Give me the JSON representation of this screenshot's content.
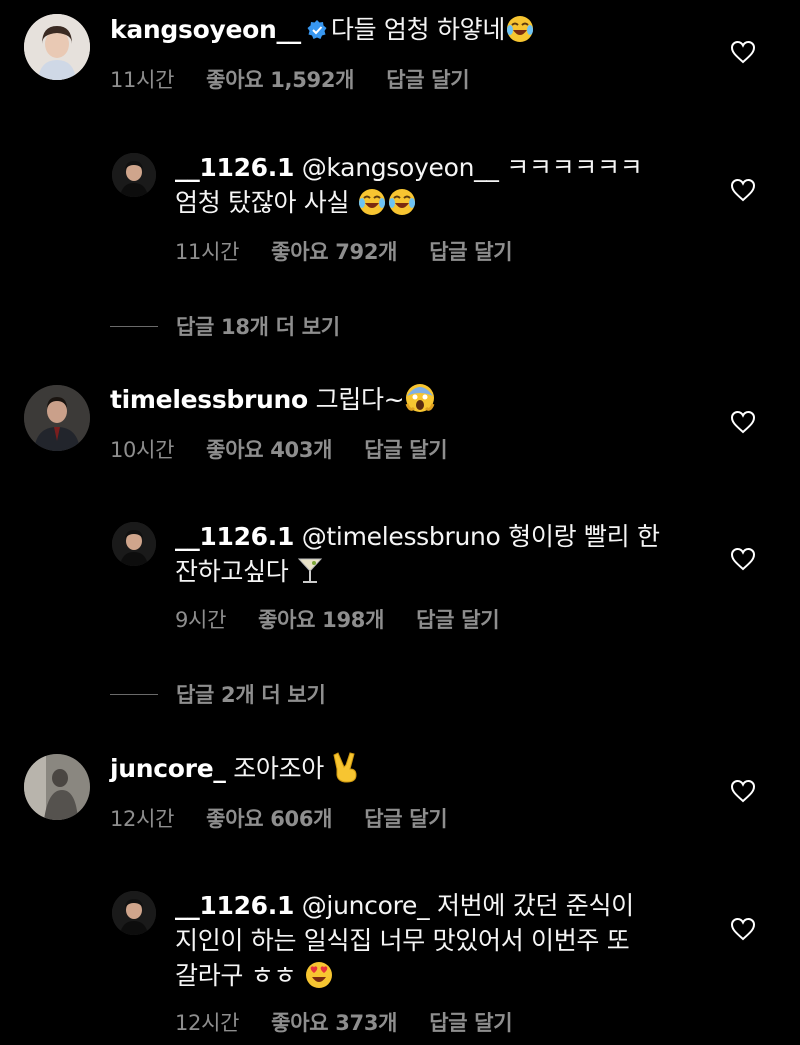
{
  "comments": [
    {
      "username": "kangsoyeon__",
      "text": "다들 엄청 하얗네",
      "time": "11시간",
      "likes": "좋아요 1,592개",
      "reply": "답글 달기",
      "emoji": "laughing-tears-icon",
      "replies": [
        {
          "username": "__1126.1",
          "text_line1": "@kangsoyeon__  ㅋㅋㅋㅋㅋㅋ",
          "text_line2": "엄청 탔잖아 사실",
          "time": "11시간",
          "likes": "좋아요 792개",
          "reply": "답글 달기"
        }
      ],
      "view_more": "답글 18개 더 보기"
    },
    {
      "username": "timelessbruno",
      "text": "그립다~",
      "time": "10시간",
      "likes": "좋아요 403개",
      "reply": "답글 달기",
      "emoji": "screaming-face-icon",
      "replies": [
        {
          "username": "__1126.1",
          "text_line1": "@timelessbruno 형이랑 빨리 한",
          "text_line2": "잔하고싶다",
          "time": "9시간",
          "likes": "좋아요 198개",
          "reply": "답글 달기"
        }
      ],
      "view_more": "답글 2개 더 보기"
    },
    {
      "username": "juncore_",
      "text": "조아조아",
      "time": "12시간",
      "likes": "좋아요 606개",
      "reply": "답글 달기",
      "emoji": "victory-hand-icon",
      "replies": [
        {
          "username": "__1126.1",
          "text_line1": "@juncore_  저번에 갔던 준식이",
          "text_line2": "지인이 하는 일식집 너무 맛있어서 이번주 또",
          "text_line3": "갈라구 ㅎㅎ",
          "time": "12시간",
          "likes": "좋아요 373개",
          "reply": "답글 달기"
        }
      ]
    }
  ],
  "colors": {
    "background": "#000000",
    "text": "#f5f5f5",
    "meta": "#8e8e8e",
    "verified": "#3897f0"
  }
}
